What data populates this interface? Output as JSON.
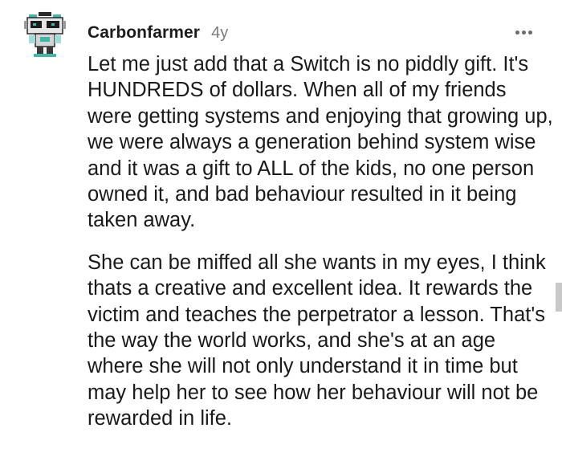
{
  "comment": {
    "author": "Carbonfarmer",
    "age": "4y",
    "more_icon": "more-horizontal-icon",
    "avatar_icon": "robot-avatar-icon",
    "paragraphs": [
      "Let me just add that a Switch is no piddly gift. It's HUNDREDS of dollars. When all of my friends were getting systems and enjoying that growing up, we were always a generation behind system wise and it was a gift to ALL of the kids, no one person owned it, and bad behaviour resulted in it being taken away.",
      "She can be miffed all she wants in my eyes, I think thats a creative and excellent idea. It rewards the victim and teaches the perpetrator a lesson. That's the way the world works, and she's at an age where she will not only understand it in time but may help her to see how her behaviour will not be rewarded in life."
    ]
  },
  "colors": {
    "text": "#1a1a1b",
    "meta": "#7c7c7c",
    "avatar_accent": "#3fb8a6"
  }
}
